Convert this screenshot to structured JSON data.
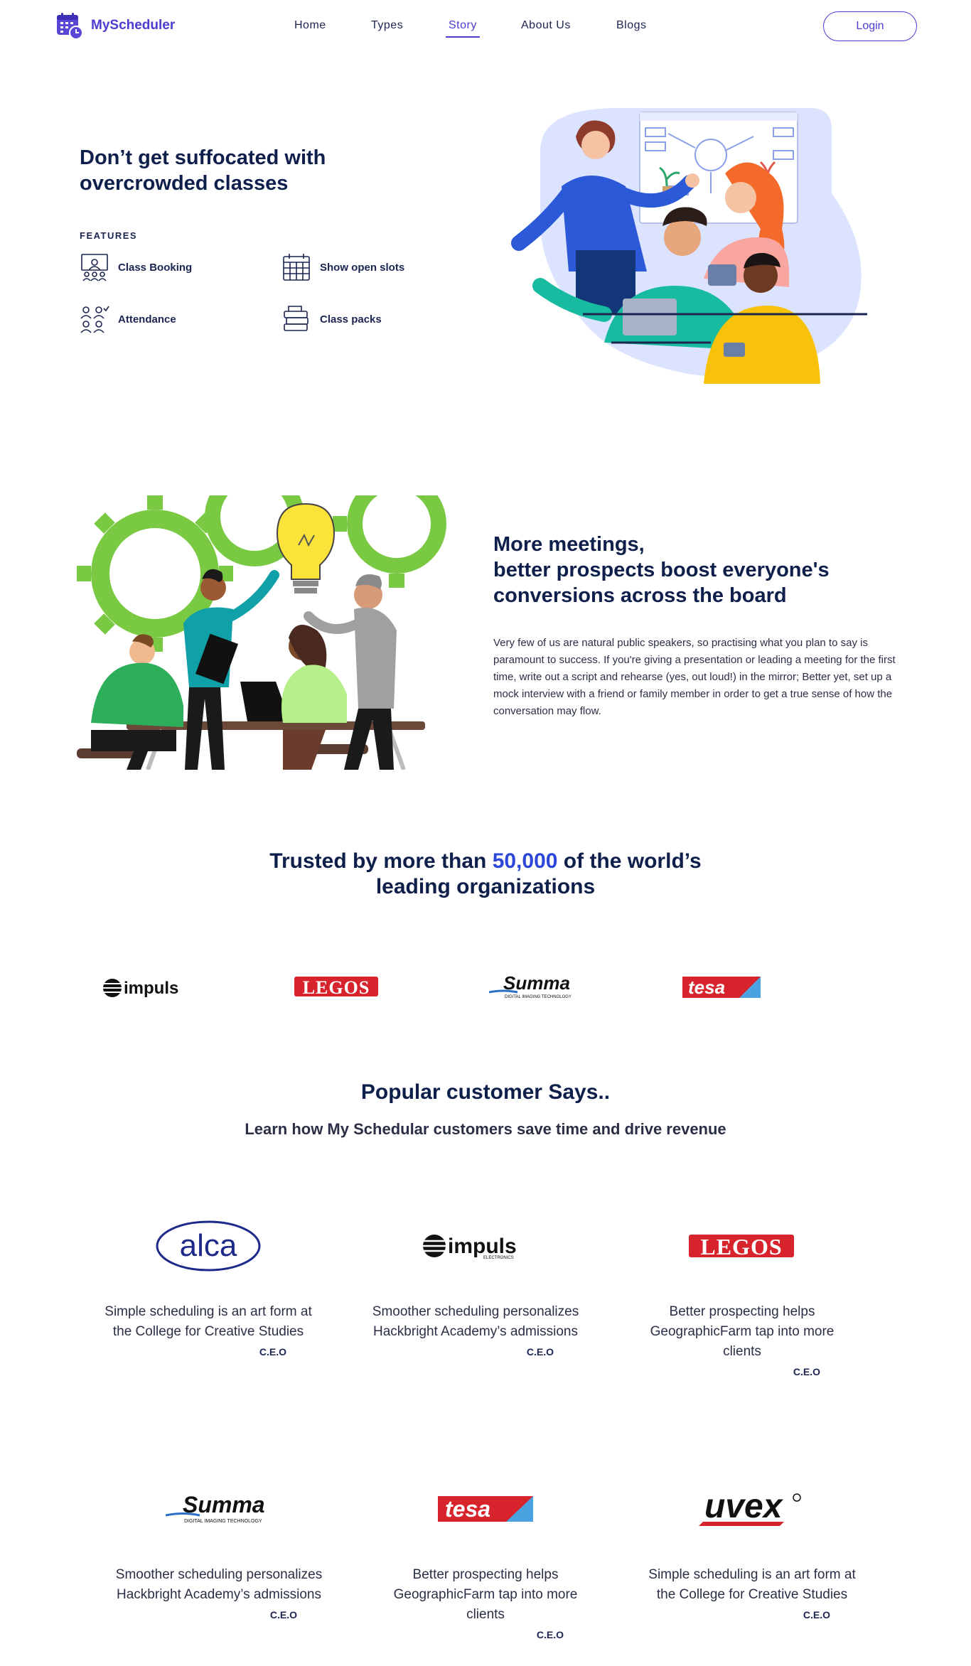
{
  "nav": {
    "brand": "MyScheduler",
    "links": [
      "Home",
      "Types",
      "Story",
      "About Us",
      "Blogs"
    ],
    "active": "Story",
    "login": "Login"
  },
  "hero": {
    "title": "Don’t get suffocated with overcrowded classes",
    "features_label": "FEATURES",
    "features": [
      "Class Booking",
      "Show open slots",
      "Attendance",
      "Class packs"
    ]
  },
  "section2": {
    "title_line1": "More meetings,",
    "title_line2": "better prospects boost everyone's",
    "title_line3": "conversions across the board",
    "paragraph": "Very few of us are natural public speakers, so practising what you plan to say is paramount to success. If you're giving a presentation or leading a meeting for the first time, write out a script and rehearse (yes, out loud!) in the mirror; Better yet, set up a mock interview with a friend or family member in order to get a true sense of how the conversation may flow."
  },
  "trusted": {
    "pre": "Trusted by more than ",
    "highlight": "50,000",
    "post": " of the world’s",
    "line2": "leading organizations"
  },
  "brands": [
    "impuls",
    "LEGOS",
    "Summa",
    "tesa"
  ],
  "testimonials": {
    "title": "Popular customer Says..",
    "subtitle": "Learn how My Schedular customers save time and drive revenue",
    "cards": [
      {
        "logo": "alca",
        "text": "Simple scheduling is an art form at the College for Creative Studies",
        "role": "C.E.O"
      },
      {
        "logo": "impuls",
        "text": "Smoother scheduling personalizes Hackbright Academy’s admissions",
        "role": "C.E.O"
      },
      {
        "logo": "LEGOS",
        "text": "Better prospecting helps GeographicFarm tap into more clients",
        "role": "C.E.O"
      },
      {
        "logo": "Summa",
        "text": "Smoother scheduling personalizes Hackbright Academy’s admissions",
        "role": "C.E.O"
      },
      {
        "logo": "tesa",
        "text": "Better prospecting helps GeographicFarm tap into more clients",
        "role": "C.E.O"
      },
      {
        "logo": "uvex",
        "text": "Simple scheduling is an art form at the College for Creative Studies",
        "role": "C.E.O"
      }
    ]
  },
  "brand_text": {
    "impuls_small": "ELECTRONICS",
    "summa_small": "DIGITAL IMAGING TECHNOLOGY"
  },
  "colors": {
    "accent": "#4c3cd0",
    "heading": "#0f1f4b",
    "highlight": "#2c47d6",
    "legos_red": "#d7232b",
    "green": "#7ac943"
  }
}
